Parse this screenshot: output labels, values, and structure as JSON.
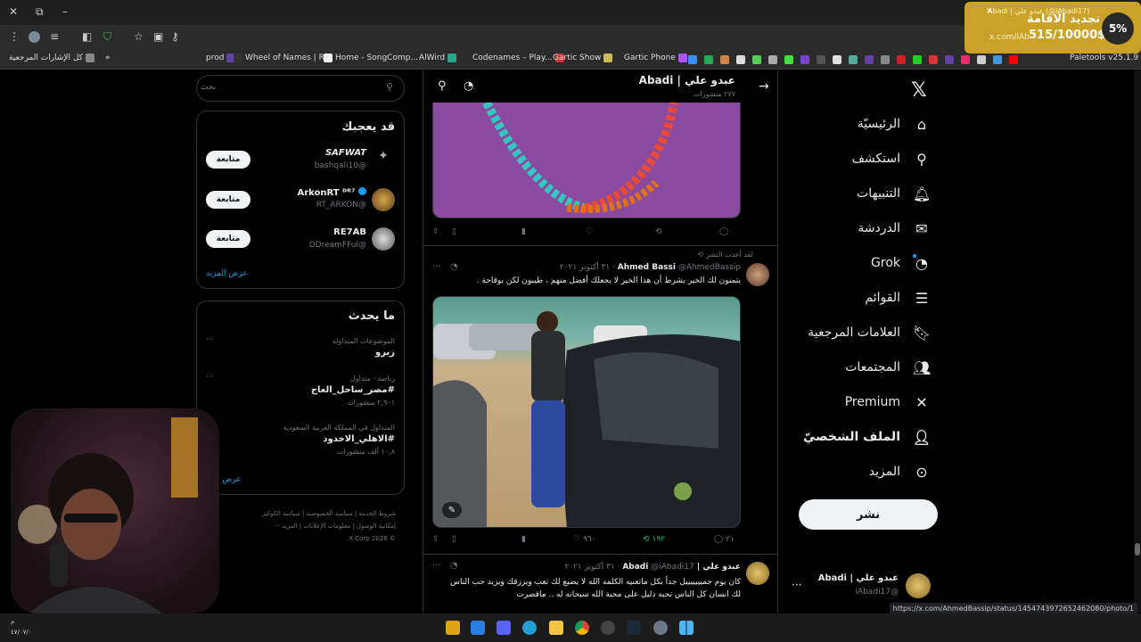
{
  "browser": {
    "bookmarks": [
      "كل الإشارات المرجعية",
      "prod",
      "Wheel of Names | R...",
      "Home - SongComp...",
      "AlWird",
      "Codenames – Play...",
      "Gartic Show",
      "Gartic Phone",
      "Paletools v25.1.9"
    ],
    "more_label": "»",
    "status_url": "https://x.com/AhmedBassip/status/1454743972652462080/photo/1"
  },
  "extension_popup": {
    "title": "تجديد الاقامة",
    "amount": "515/10000$",
    "percent": "5%",
    "url": "x.com/iAb",
    "tab_title": "Abadi | عبدو علي (@iAbadi17)"
  },
  "nav": {
    "items": [
      {
        "label": "الرئيسيّة",
        "icon": "home-icon"
      },
      {
        "label": "استكشف",
        "icon": "search-icon"
      },
      {
        "label": "التنبيهات",
        "icon": "bell-icon"
      },
      {
        "label": "الدردشة",
        "icon": "mail-icon"
      },
      {
        "label": "Grok",
        "icon": "grok-icon"
      },
      {
        "label": "القوائم",
        "icon": "list-icon"
      },
      {
        "label": "العلامات المرجعية",
        "icon": "bookmark-icon"
      },
      {
        "label": "المجتمعات",
        "icon": "people-icon"
      },
      {
        "label": "Premium",
        "icon": "x-icon"
      },
      {
        "label": "الملف الشخصيّ",
        "icon": "person-icon"
      },
      {
        "label": "المزيد",
        "icon": "more-circle-icon"
      }
    ],
    "post_label": "نشر",
    "account_name": "عبدو علي | Abadi",
    "account_handle": "@iAbadi17"
  },
  "feed": {
    "header_name": "عبدو علي | Abadi",
    "header_posts": "٢٧٧ منشورات",
    "tweet1": {
      "reply": "",
      "retweet": "",
      "like": "",
      "views": ""
    },
    "tweet2": {
      "repost_note": "لقد أعدت النشر",
      "name": "Ahmed Bassi",
      "handle_date": "@AhmedBassip · ٣١ أكتوبر ٢٠٢١",
      "text": "يتمنون لك الخير بشرط أن هذا الخير لا يجعلك أفضل منهم ، طيبون لكن بوقاحة .",
      "replies": "٢١",
      "retweets": "١٩٢",
      "likes": "٩٦٠"
    },
    "tweet3": {
      "name": "عبدو علي | Abadi",
      "handle_date": "@iAbadi17 · ٣١ أكتوبر ٢٠٢١",
      "text": "كان يوم جميييييييل جداً بكل ماتعنيه الكلمه الله لا يضيع لك تعب ويرزقك ويزيد حب الناس لك انسان كل الناس تحبه دليل على محبة الله سبحانه له .. ماقصرت"
    }
  },
  "sidebar": {
    "search_placeholder": "بحث",
    "who_to_follow_title": "قد يعجبك",
    "follow_label": "متابعة",
    "suggestions": [
      {
        "name": "SAFWAT",
        "handle": "@bashqali10"
      },
      {
        "name": "ArkonRT ᴰᴿ⁷",
        "handle": "@RT_ARKON"
      },
      {
        "name": "RE7AB",
        "handle": "@DDreamFFul"
      }
    ],
    "show_more": "عرض المزيد",
    "trends_title": "ما يحدث",
    "trends": [
      {
        "context": "الموضوعات المتداوَلة",
        "name": "زيرو",
        "count": ""
      },
      {
        "context": "رياضة · متداول",
        "name": "#مصر_ساحل_العاج",
        "count": "٢,٩٠١ منشورات"
      },
      {
        "context": "المتداول في المملكة العربية السعودية",
        "name": "#الاهلي_الاخدود",
        "count": "١٠,٨ ألف منشورات"
      }
    ],
    "trends_more": "عرض المز",
    "footer": [
      "شروط الخدمة",
      "سياسة الخصوصية",
      "سياسة الكوكيز",
      "إمكانية الوصول",
      "معلومات الإعلانات",
      "المزيد ···",
      "© 2026 X Corp."
    ]
  },
  "taskbar": {
    "clock_time": "م",
    "clock_date": "٤٧/٠٧/٠"
  }
}
